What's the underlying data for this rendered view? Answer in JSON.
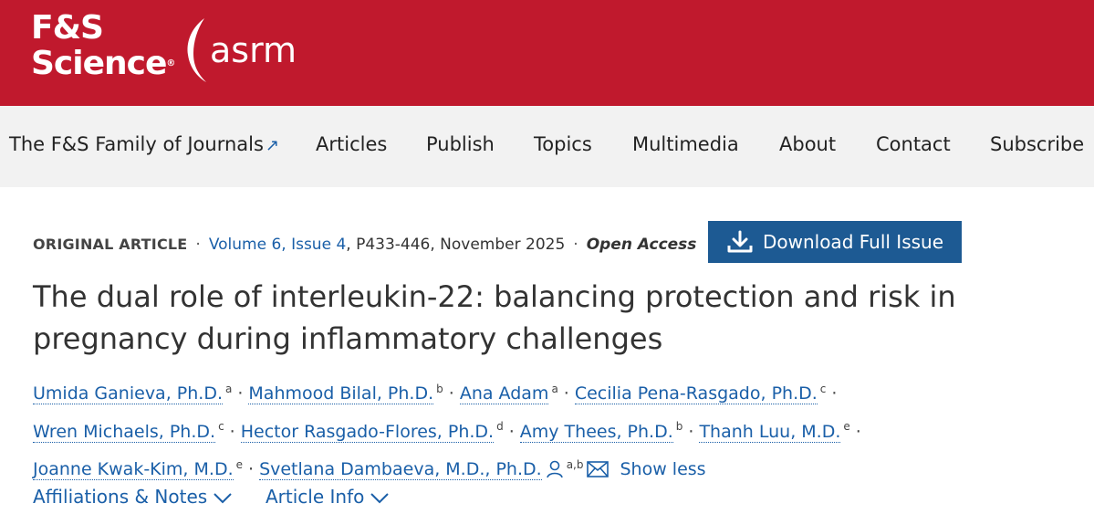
{
  "header": {
    "brand_line1": "F&S",
    "brand_line2": "Science",
    "brand_reg": "®",
    "partner_logo_text": "asrm",
    "bg_color": "#c0192d"
  },
  "nav": {
    "items": [
      {
        "label": "The F&S Family of Journals",
        "external_icon": "↗"
      },
      {
        "label": "Articles"
      },
      {
        "label": "Publish"
      },
      {
        "label": "Topics"
      },
      {
        "label": "Multimedia"
      },
      {
        "label": "About"
      },
      {
        "label": "Contact"
      },
      {
        "label": "Subscribe"
      }
    ]
  },
  "article_meta": {
    "type": "ORIGINAL ARTICLE",
    "volume_issue": "Volume 6, Issue 4",
    "pages_date": "P433-446, November 2025",
    "access": "Open Access",
    "download_label": "Download Full Issue",
    "download_icon": "download-icon",
    "button_color": "#1d5a93"
  },
  "title": "The dual role of interleukin-22: balancing protection and risk in pregnancy during inflammatory challenges",
  "authors": [
    {
      "name": "Umida Ganieva, Ph.D.",
      "aff": "a"
    },
    {
      "name": "Mahmood Bilal, Ph.D.",
      "aff": "b"
    },
    {
      "name": "Ana Adam",
      "aff": "a"
    },
    {
      "name": "Cecilia Pena-Rasgado, Ph.D.",
      "aff": "c"
    },
    {
      "name": "Wren Michaels, Ph.D.",
      "aff": "c"
    },
    {
      "name": "Hector Rasgado-Flores, Ph.D.",
      "aff": "d"
    },
    {
      "name": "Amy Thees, Ph.D.",
      "aff": "b"
    },
    {
      "name": "Thanh Luu, M.D.",
      "aff": "e"
    },
    {
      "name": "Joanne Kwak-Kim, M.D.",
      "aff": "e"
    },
    {
      "name": "Svetlana Dambaeva, M.D., Ph.D.",
      "aff": "a,b"
    }
  ],
  "show_less": "Show less",
  "bottom_links": {
    "affiliations": "Affiliations & Notes",
    "article_info": "Article Info"
  },
  "link_color": "#1a5fa8"
}
